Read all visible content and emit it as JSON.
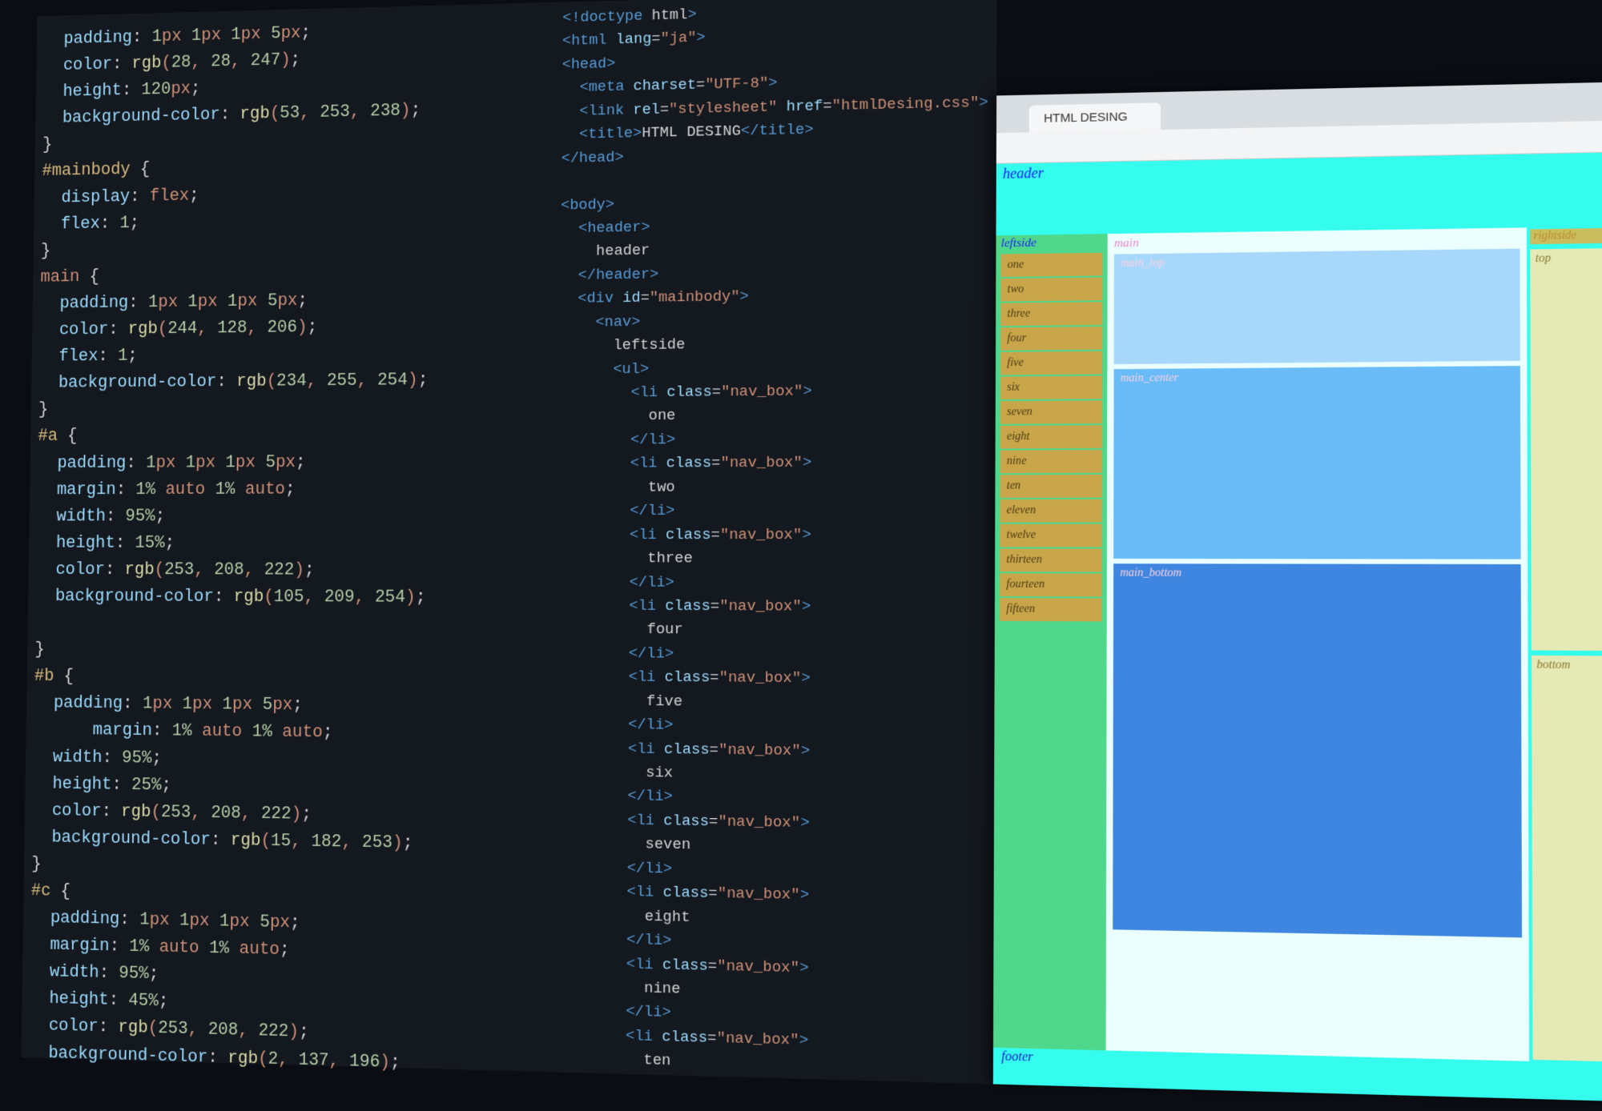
{
  "css_pane": {
    "lines": [
      {
        "t": "  padding: 1px 1px 1px 5px;"
      },
      {
        "t": "  color: rgb(28, 28, 247);"
      },
      {
        "t": "  height: 120px;"
      },
      {
        "t": "  background-color: rgb(53, 253, 238);"
      },
      {
        "t": "}"
      },
      {
        "t": "#mainbody {",
        "sel": "#mainbody"
      },
      {
        "t": "  display:flex;"
      },
      {
        "t": "  flex: 1;"
      },
      {
        "t": "}"
      },
      {
        "t": "main {",
        "sel": "main"
      },
      {
        "t": "  padding: 1px 1px 1px 5px;"
      },
      {
        "t": "  color: rgb(244, 128, 206);"
      },
      {
        "t": "  flex: 1;"
      },
      {
        "t": "  background-color: rgb(234, 255, 254);"
      },
      {
        "t": "}"
      },
      {
        "t": "#a {",
        "sel": "#a"
      },
      {
        "t": "  padding: 1px 1px 1px 5px;"
      },
      {
        "t": "  margin: 1% auto 1% auto;"
      },
      {
        "t": "  width: 95%;"
      },
      {
        "t": "  height: 15%;"
      },
      {
        "t": "  color: rgb(253, 208, 222);"
      },
      {
        "t": "  background-color: rgb(105, 209, 254);"
      },
      {
        "t": ""
      },
      {
        "t": "}"
      },
      {
        "t": "#b {",
        "sel": "#b"
      },
      {
        "t": "  padding: 1px 1px 1px 5px;"
      },
      {
        "t": "      margin: 1% auto 1% auto;"
      },
      {
        "t": "  width: 95%;"
      },
      {
        "t": "  height: 25%;"
      },
      {
        "t": "  color: rgb(253, 208, 222);"
      },
      {
        "t": "  background-color: rgb(15, 182, 253);"
      },
      {
        "t": "}"
      },
      {
        "t": "#c {",
        "sel": "#c"
      },
      {
        "t": "  padding: 1px 1px 1px 5px;"
      },
      {
        "t": "  margin: 1% auto 1% auto;"
      },
      {
        "t": "  width: 95%;"
      },
      {
        "t": "  height: 45%;"
      },
      {
        "t": "  color: rgb(253, 208, 222);"
      },
      {
        "t": "  background-color: rgb(2, 137, 196);"
      }
    ]
  },
  "html_pane": {
    "lines": [
      "<!doctype html>",
      "<html lang=\"ja\">",
      "<head>",
      "  <meta charset=\"UTF-8\">",
      "  <link rel=\"stylesheet\" href=\"htmlDesing.css\">",
      "  <title>HTML DESING</title>",
      "</head>",
      "",
      "<body>",
      "  <header>",
      "    header",
      "  </header>",
      "  <div id=\"mainbody\">",
      "    <nav>",
      "      leftside",
      "      <ul>",
      "        <li class=\"nav_box\">",
      "          one",
      "        </li>",
      "        <li class=\"nav_box\">",
      "          two",
      "        </li>",
      "        <li class=\"nav_box\">",
      "          three",
      "        </li>",
      "        <li class=\"nav_box\">",
      "          four",
      "        </li>",
      "        <li class=\"nav_box\">",
      "          five",
      "        </li>",
      "        <li class=\"nav_box\">",
      "          six",
      "        </li>",
      "        <li class=\"nav_box\">",
      "          seven",
      "        </li>",
      "        <li class=\"nav_box\">",
      "          eight",
      "        </li>",
      "        <li class=\"nav_box\">",
      "          nine",
      "        </li>",
      "        <li class=\"nav_box\">",
      "          ten"
    ]
  },
  "preview": {
    "tab_title": "HTML DESING",
    "header": "header",
    "leftside_label": "leftside",
    "nav_items": [
      "one",
      "two",
      "three",
      "four",
      "five",
      "six",
      "seven",
      "eight",
      "nine",
      "ten",
      "eleven",
      "twelve",
      "thirteen",
      "fourteen",
      "fifteen"
    ],
    "main_label": "main",
    "main_top": "main_top",
    "main_center": "main_center",
    "main_bottom": "main_bottom",
    "rightside_label": "rightside",
    "rs_top": "top",
    "rs_bottom": "bottom",
    "footer": "footer"
  }
}
